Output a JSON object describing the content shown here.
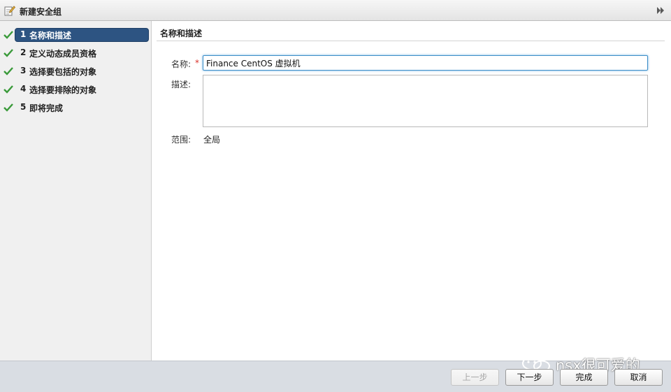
{
  "window": {
    "title": "新建安全组"
  },
  "steps": [
    {
      "num": "1",
      "label": "名称和描述",
      "completed": true,
      "active": true
    },
    {
      "num": "2",
      "label": "定义动态成员资格",
      "completed": true,
      "active": false
    },
    {
      "num": "3",
      "label": "选择要包括的对象",
      "completed": true,
      "active": false
    },
    {
      "num": "4",
      "label": "选择要排除的对象",
      "completed": true,
      "active": false
    },
    {
      "num": "5",
      "label": "即将完成",
      "completed": true,
      "active": false
    }
  ],
  "main": {
    "section_title": "名称和描述",
    "name_label": "名称:",
    "required_mark": "*",
    "name_value": "Finance CentOS 虚拟机",
    "description_label": "描述:",
    "description_value": "",
    "scope_label": "范围:",
    "scope_value": "全局"
  },
  "footer": {
    "back_label": "上一步",
    "next_label": "下一步",
    "finish_label": "完成",
    "cancel_label": "取消"
  },
  "watermark": {
    "text": "nsx很可爱的"
  },
  "colors": {
    "active_step_bg": "#2d5482",
    "check_green": "#3a9a3a",
    "focus_border": "#3c8ec8",
    "required_red": "#d9322b"
  },
  "icons": {
    "title": "edit-security-group-icon",
    "expand": "double-chevron-right-icon",
    "step_status": "checkmark-icon"
  }
}
